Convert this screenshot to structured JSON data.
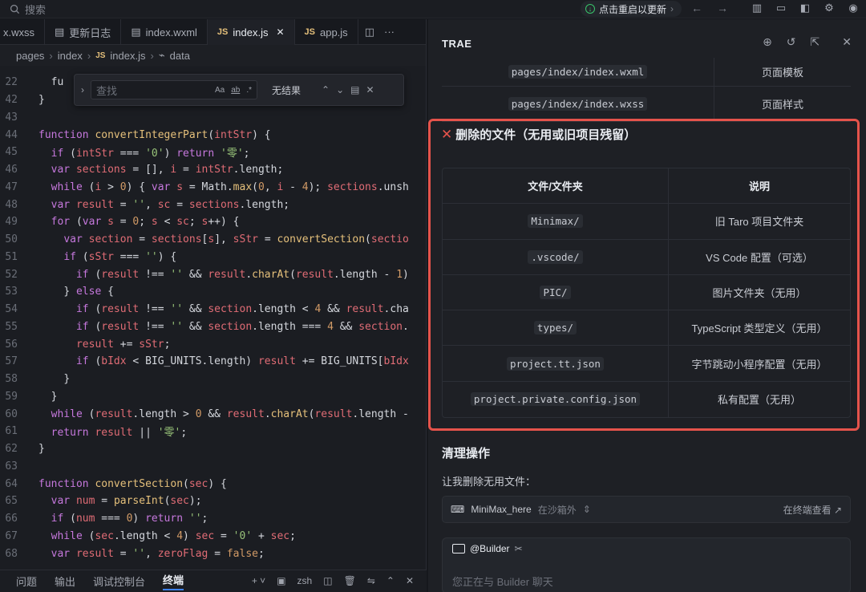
{
  "topbar": {
    "search_label": "搜索",
    "restart_label": "点击重启以更新",
    "colors": {
      "accent_green": "#39c46a"
    }
  },
  "editor": {
    "tabs": [
      {
        "label": "x.wxss",
        "kind": "wxss"
      },
      {
        "label": "更新日志",
        "kind": "doc"
      },
      {
        "label": "index.wxml",
        "kind": "doc"
      },
      {
        "label": "index.js",
        "kind": "js",
        "active": true
      },
      {
        "label": "app.js",
        "kind": "js"
      }
    ],
    "js_badge": "JS",
    "breadcrumb": [
      "pages",
      "index",
      "index.js",
      "data"
    ],
    "find": {
      "placeholder": "查找",
      "result": "无结果",
      "opt_case": "Aa",
      "opt_word": "ab",
      "opt_regex": ".*"
    },
    "lines": [
      {
        "n": "22",
        "html": "  <span class=\"plain\">fu</span>"
      },
      {
        "n": "42",
        "html": "<span class=\"plain\">}</span>"
      },
      {
        "n": "43",
        "html": ""
      },
      {
        "n": "44",
        "html": "<span class=\"kw\">function</span> <span class=\"fn\">convertIntegerPart</span><span class=\"plain\">(</span><span class=\"var\">intStr</span><span class=\"plain\">) {</span>"
      },
      {
        "n": "45",
        "html": "  <span class=\"kw\">if</span> <span class=\"plain\">(</span><span class=\"var\">intStr</span> <span class=\"plain\">=== </span><span class=\"str\">'0'</span><span class=\"plain\">) </span><span class=\"kw\">return</span> <span class=\"str\">'零'</span><span class=\"plain\">;</span>"
      },
      {
        "n": "46",
        "html": "  <span class=\"kw\">var</span> <span class=\"var\">sections</span> <span class=\"plain\">= [], </span><span class=\"var\">i</span> <span class=\"plain\">= </span><span class=\"var\">intStr</span><span class=\"plain\">.length;</span>"
      },
      {
        "n": "47",
        "html": "  <span class=\"kw\">while</span> <span class=\"plain\">(</span><span class=\"var\">i</span> <span class=\"plain\">&gt; </span><span class=\"num\">0</span><span class=\"plain\">) { </span><span class=\"kw\">var</span> <span class=\"var\">s</span> <span class=\"plain\">= Math.</span><span class=\"fn\">max</span><span class=\"plain\">(</span><span class=\"num\">0</span><span class=\"plain\">, </span><span class=\"var\">i</span> <span class=\"plain\">- </span><span class=\"num\">4</span><span class=\"plain\">); </span><span class=\"var\">sections</span><span class=\"plain\">.unsh</span>"
      },
      {
        "n": "48",
        "html": "  <span class=\"kw\">var</span> <span class=\"var\">result</span> <span class=\"plain\">= </span><span class=\"str\">''</span><span class=\"plain\">, </span><span class=\"var\">sc</span> <span class=\"plain\">= </span><span class=\"var\">sections</span><span class=\"plain\">.length;</span>"
      },
      {
        "n": "49",
        "html": "  <span class=\"kw\">for</span> <span class=\"plain\">(</span><span class=\"kw\">var</span> <span class=\"var\">s</span> <span class=\"plain\">= </span><span class=\"num\">0</span><span class=\"plain\">; </span><span class=\"var\">s</span> <span class=\"plain\">&lt; </span><span class=\"var\">sc</span><span class=\"plain\">; </span><span class=\"var\">s</span><span class=\"plain\">++) {</span>"
      },
      {
        "n": "50",
        "html": "    <span class=\"kw\">var</span> <span class=\"var\">section</span> <span class=\"plain\">= </span><span class=\"var\">sections</span><span class=\"plain\">[</span><span class=\"var\">s</span><span class=\"plain\">], </span><span class=\"var\">sStr</span> <span class=\"plain\">= </span><span class=\"fn\">convertSection</span><span class=\"plain\">(</span><span class=\"var\">sectio</span>"
      },
      {
        "n": "51",
        "html": "    <span class=\"kw\">if</span> <span class=\"plain\">(</span><span class=\"var\">sStr</span> <span class=\"plain\">=== </span><span class=\"str\">''</span><span class=\"plain\">) {</span>"
      },
      {
        "n": "52",
        "html": "      <span class=\"kw\">if</span> <span class=\"plain\">(</span><span class=\"var\">result</span> <span class=\"plain\">!== </span><span class=\"str\">''</span> <span class=\"plain\">&amp;&amp; </span><span class=\"var\">result</span><span class=\"plain\">.</span><span class=\"fn\">charAt</span><span class=\"plain\">(</span><span class=\"var\">result</span><span class=\"plain\">.length - </span><span class=\"num\">1</span><span class=\"plain\">)</span>"
      },
      {
        "n": "53",
        "html": "    <span class=\"plain\">} </span><span class=\"kw\">else</span> <span class=\"plain\">{</span>"
      },
      {
        "n": "54",
        "html": "      <span class=\"kw\">if</span> <span class=\"plain\">(</span><span class=\"var\">result</span> <span class=\"plain\">!== </span><span class=\"str\">''</span> <span class=\"plain\">&amp;&amp; </span><span class=\"var\">section</span><span class=\"plain\">.length &lt; </span><span class=\"num\">4</span> <span class=\"plain\">&amp;&amp; </span><span class=\"var\">result</span><span class=\"plain\">.cha</span>"
      },
      {
        "n": "55",
        "html": "      <span class=\"kw\">if</span> <span class=\"plain\">(</span><span class=\"var\">result</span> <span class=\"plain\">!== </span><span class=\"str\">''</span> <span class=\"plain\">&amp;&amp; </span><span class=\"var\">section</span><span class=\"plain\">.length === </span><span class=\"num\">4</span> <span class=\"plain\">&amp;&amp; </span><span class=\"var\">section</span><span class=\"plain\">.</span>"
      },
      {
        "n": "56",
        "html": "      <span class=\"var\">result</span> <span class=\"plain\">+= </span><span class=\"var\">sStr</span><span class=\"plain\">;</span>"
      },
      {
        "n": "57",
        "html": "      <span class=\"kw\">if</span> <span class=\"plain\">(</span><span class=\"var\">bIdx</span> <span class=\"plain\">&lt; BIG_UNITS.length) </span><span class=\"var\">result</span> <span class=\"plain\">+= BIG_UNITS[</span><span class=\"var\">bIdx</span>"
      },
      {
        "n": "58",
        "html": "    <span class=\"plain\">}</span>"
      },
      {
        "n": "59",
        "html": "  <span class=\"plain\">}</span>"
      },
      {
        "n": "60",
        "html": "  <span class=\"kw\">while</span> <span class=\"plain\">(</span><span class=\"var\">result</span><span class=\"plain\">.length &gt; </span><span class=\"num\">0</span> <span class=\"plain\">&amp;&amp; </span><span class=\"var\">result</span><span class=\"plain\">.</span><span class=\"fn\">charAt</span><span class=\"plain\">(</span><span class=\"var\">result</span><span class=\"plain\">.length -</span>"
      },
      {
        "n": "61",
        "html": "  <span class=\"kw\">return</span> <span class=\"var\">result</span> <span class=\"plain\">|| </span><span class=\"str\">'零'</span><span class=\"plain\">;</span>"
      },
      {
        "n": "62",
        "html": "<span class=\"plain\">}</span>"
      },
      {
        "n": "63",
        "html": ""
      },
      {
        "n": "64",
        "html": "<span class=\"kw\">function</span> <span class=\"fn\">convertSection</span><span class=\"plain\">(</span><span class=\"var\">sec</span><span class=\"plain\">) {</span>"
      },
      {
        "n": "65",
        "html": "  <span class=\"kw\">var</span> <span class=\"var\">num</span> <span class=\"plain\">= </span><span class=\"fn\">parseInt</span><span class=\"plain\">(</span><span class=\"var\">sec</span><span class=\"plain\">);</span>"
      },
      {
        "n": "66",
        "html": "  <span class=\"kw\">if</span> <span class=\"plain\">(</span><span class=\"var\">num</span> <span class=\"plain\">=== </span><span class=\"num\">0</span><span class=\"plain\">) </span><span class=\"kw\">return</span> <span class=\"str\">''</span><span class=\"plain\">;</span>"
      },
      {
        "n": "67",
        "html": "  <span class=\"kw\">while</span> <span class=\"plain\">(</span><span class=\"var\">sec</span><span class=\"plain\">.length &lt; </span><span class=\"num\">4</span><span class=\"plain\">) </span><span class=\"var\">sec</span> <span class=\"plain\">= </span><span class=\"str\">'0'</span> <span class=\"plain\">+ </span><span class=\"var\">sec</span><span class=\"plain\">;</span>"
      },
      {
        "n": "68",
        "html": "  <span class=\"kw\">var</span> <span class=\"var\">result</span> <span class=\"plain\">= </span><span class=\"str\">''</span><span class=\"plain\">, </span><span class=\"var\">zeroFlag</span> <span class=\"plain\">= </span><span class=\"num\">false</span><span class=\"plain\">;</span>"
      }
    ]
  },
  "panel": {
    "tabs": [
      "问题",
      "输出",
      "调试控制台",
      "终端"
    ],
    "active": "终端",
    "shell": "zsh"
  },
  "chat": {
    "title": "TRAE",
    "old_rows": [
      {
        "file": "pages/index/index.wxml",
        "desc": "页面模板"
      },
      {
        "file": "pages/index/index.wxss",
        "desc": "页面样式"
      }
    ],
    "delete_title": "删除的文件（无用或旧项目残留）",
    "table_headers": {
      "file": "文件/文件夹",
      "desc": "说明"
    },
    "deleted": [
      {
        "file": "Minimax/",
        "desc": "旧 Taro 项目文件夹"
      },
      {
        "file": ".vscode/",
        "desc": "VS Code 配置（可选）"
      },
      {
        "file": "PIC/",
        "desc": "图片文件夹（无用）"
      },
      {
        "file": "types/",
        "desc": "TypeScript 类型定义（无用）"
      },
      {
        "file": "project.tt.json",
        "desc": "字节跳动小程序配置（无用）"
      },
      {
        "file": "project.private.config.json",
        "desc": "私有配置（无用）"
      }
    ],
    "clean_title": "清理操作",
    "clean_desc": "让我删除无用文件：",
    "terminal_card": {
      "name": "MiniMax_here",
      "scope": "在沙箱外",
      "view": "在终端查看"
    },
    "builder_label": "@Builder",
    "input_placeholder": "您正在与 Builder 聊天",
    "colors": {
      "highlight": "#e5534b"
    }
  }
}
